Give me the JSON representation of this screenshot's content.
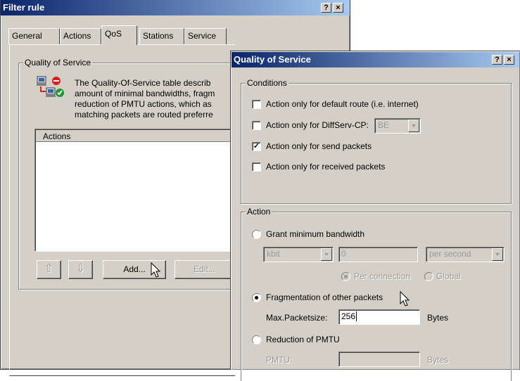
{
  "back_dialog": {
    "title": "Filter rule",
    "help_btn": "?",
    "close_btn": "×",
    "tabs": [
      "General",
      "Actions",
      "QoS",
      "Stations",
      "Service"
    ],
    "group_label": "Quality of Service",
    "description": [
      "The Quality-Of-Service table describ",
      "amount of minimal bandwidths, fragm",
      "reduction of PMTU actions, which as",
      "matching packets are routed preferre"
    ],
    "list_header": "Actions",
    "up_btn": "⇧",
    "down_btn": "⇩",
    "add_btn": "Add...",
    "edit_btn": "Edit..."
  },
  "front_dialog": {
    "title": "Quality of Service",
    "help_btn": "?",
    "close_btn": "×",
    "conditions_label": "Conditions",
    "conditions": [
      {
        "label": "Action only for default route (i.e. internet)",
        "checked": false
      },
      {
        "label": "Action only for DiffServ-CP:",
        "checked": false
      },
      {
        "label": "Action only for send packets",
        "checked": true
      },
      {
        "label": "Action only for received packets",
        "checked": false
      }
    ],
    "diffserv_value": "BE",
    "action_label": "Action",
    "grant_label": "Grant minimum bandwidth",
    "unit_value": "kbit",
    "bandwidth_value": "0",
    "period_value": "per second",
    "per_connection_label": "Per connection",
    "global_label": "Global",
    "fragmentation_label": "Fragmentation of other packets",
    "max_packetsize_label": "Max.Packetsize:",
    "max_packetsize_value": "256",
    "bytes_label": "Bytes",
    "reduction_label": "Reduction of PMTU",
    "pmtu_label": "PMTU:",
    "pmtu_value": "",
    "pmtu_bytes_label": "Bytes"
  }
}
